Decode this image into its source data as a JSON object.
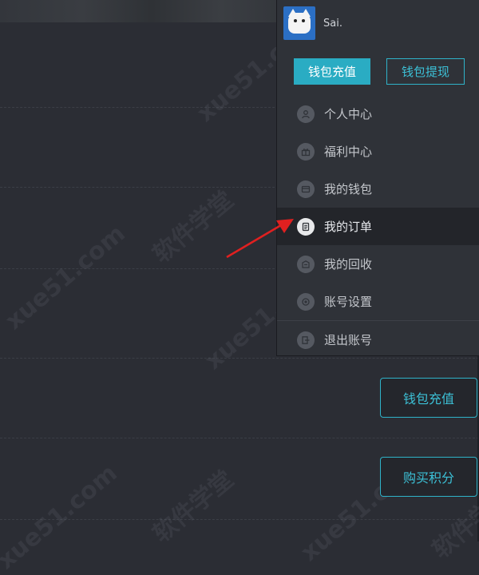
{
  "user": {
    "name": "Sai."
  },
  "wallet": {
    "recharge_label": "钱包充值",
    "withdraw_label": "钱包提现"
  },
  "menu": {
    "items": [
      {
        "label": "个人中心",
        "icon": "user-icon"
      },
      {
        "label": "福利中心",
        "icon": "gift-icon"
      },
      {
        "label": "我的钱包",
        "icon": "wallet-icon"
      },
      {
        "label": "我的订单",
        "icon": "order-icon",
        "active": true
      },
      {
        "label": "我的回收",
        "icon": "recycle-icon"
      },
      {
        "label": "账号设置",
        "icon": "settings-icon"
      },
      {
        "label": "退出账号",
        "icon": "logout-icon"
      }
    ]
  },
  "side_buttons": {
    "recharge_label": "钱包充值",
    "buy_points_label": "购买积分"
  },
  "watermark": {
    "text": "软件学堂",
    "site": "xue51.com"
  },
  "colors": {
    "accent": "#2aacc3",
    "background": "#2b2d34",
    "annotation_arrow": "#e02020"
  }
}
